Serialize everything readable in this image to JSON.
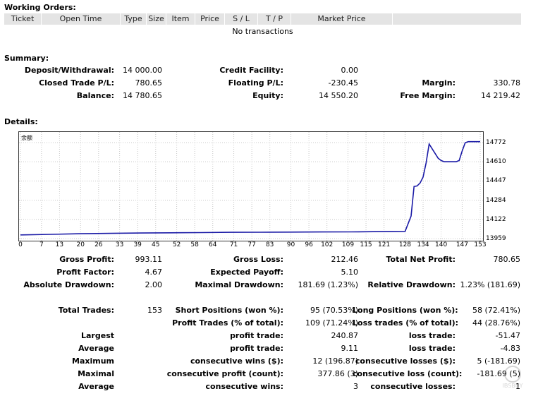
{
  "working_orders": {
    "title": "Working Orders:",
    "columns": [
      "Ticket",
      "Open Time",
      "Type",
      "Size",
      "Item",
      "Price",
      "S / L",
      "T / P",
      "Market Price"
    ],
    "empty_text": "No transactions"
  },
  "summary": {
    "title": "Summary:",
    "deposit_label": "Deposit/Withdrawal:",
    "deposit_value": "14 000.00",
    "credit_label": "Credit Facility:",
    "credit_value": "0.00",
    "closed_label": "Closed Trade P/L:",
    "closed_value": "780.65",
    "floating_label": "Floating P/L:",
    "floating_value": "-230.45",
    "margin_label": "Margin:",
    "margin_value": "330.78",
    "balance_label": "Balance:",
    "balance_value": "14 780.65",
    "equity_label": "Equity:",
    "equity_value": "14 550.20",
    "free_margin_label": "Free Margin:",
    "free_margin_value": "14 219.42"
  },
  "details": {
    "title": "Details:",
    "chart_label": "余额"
  },
  "chart_data": {
    "type": "line",
    "title": "",
    "xlabel": "",
    "ylabel": "",
    "x_ticks": [
      "0",
      "7",
      "13",
      "20",
      "26",
      "33",
      "39",
      "45",
      "52",
      "58",
      "64",
      "71",
      "77",
      "83",
      "90",
      "96",
      "102",
      "109",
      "115",
      "121",
      "128",
      "134",
      "140",
      "147",
      "153"
    ],
    "y_ticks": [
      "14772",
      "14610",
      "14447",
      "14284",
      "14122",
      "13959"
    ],
    "ylim": [
      13959,
      14772
    ],
    "xlim": [
      0,
      153
    ],
    "grid": true,
    "series": [
      {
        "color": "#1a1aa6",
        "x": [
          0,
          10,
          20,
          30,
          40,
          50,
          60,
          70,
          80,
          90,
          100,
          110,
          120,
          128,
          130,
          131,
          132,
          133,
          134,
          135,
          136,
          137,
          138,
          139,
          140,
          141,
          142,
          143,
          144,
          145,
          146,
          147,
          148,
          149,
          150,
          151,
          152,
          153
        ],
        "y": [
          13990,
          13995,
          14000,
          14003,
          14006,
          14008,
          14010,
          14012,
          14013,
          14014,
          14015,
          14016,
          14018,
          14020,
          14150,
          14400,
          14405,
          14430,
          14480,
          14600,
          14760,
          14720,
          14680,
          14640,
          14620,
          14610,
          14610,
          14610,
          14610,
          14610,
          14620,
          14700,
          14770,
          14780,
          14780,
          14780,
          14780,
          14780
        ]
      }
    ]
  },
  "stats": {
    "gross_profit_label": "Gross Profit:",
    "gross_profit_value": "993.11",
    "gross_loss_label": "Gross Loss:",
    "gross_loss_value": "212.46",
    "total_net_label": "Total Net Profit:",
    "total_net_value": "780.65",
    "profit_factor_label": "Profit Factor:",
    "profit_factor_value": "4.67",
    "expected_payoff_label": "Expected Payoff:",
    "expected_payoff_value": "5.10",
    "abs_dd_label": "Absolute Drawdown:",
    "abs_dd_value": "2.00",
    "max_dd_label": "Maximal Drawdown:",
    "max_dd_value": "181.69 (1.23%)",
    "rel_dd_label": "Relative Drawdown:",
    "rel_dd_value": "1.23% (181.69)",
    "total_trades_label": "Total Trades:",
    "total_trades_value": "153",
    "short_label": "Short Positions (won %):",
    "short_value": "95 (70.53%)",
    "long_label": "Long Positions (won %):",
    "long_value": "58 (72.41%)",
    "profit_trades_label": "Profit Trades (% of total):",
    "profit_trades_value": "109 (71.24%)",
    "loss_trades_label": "Loss trades (% of total):",
    "loss_trades_value": "44 (28.76%)",
    "largest_label": "Largest",
    "largest_profit_label": "profit trade:",
    "largest_profit_value": "240.87",
    "largest_loss_label": "loss trade:",
    "largest_loss_value": "-51.47",
    "average_label": "Average",
    "average_profit_label": "profit trade:",
    "average_profit_value": "9.11",
    "average_loss_label": "loss trade:",
    "average_loss_value": "-4.83",
    "maximum_label": "Maximum",
    "max_wins_label": "consecutive wins ($):",
    "max_wins_value": "12 (196.87)",
    "max_losses_label": "consecutive losses ($):",
    "max_losses_value": "5 (-181.69)",
    "maximal_label": "Maximal",
    "maximal_profit_label": "consecutive profit (count):",
    "maximal_profit_value": "377.86 (3)",
    "maximal_loss_label": "consecutive loss (count):",
    "maximal_loss_value": "-181.69 (5)",
    "average2_label": "Average",
    "avg_wins_label": "consecutive wins:",
    "avg_wins_value": "3",
    "avg_losses_label": "consecutive losses:",
    "avg_losses_value": "1"
  },
  "watermark": {
    "text": "IBSBUY"
  }
}
